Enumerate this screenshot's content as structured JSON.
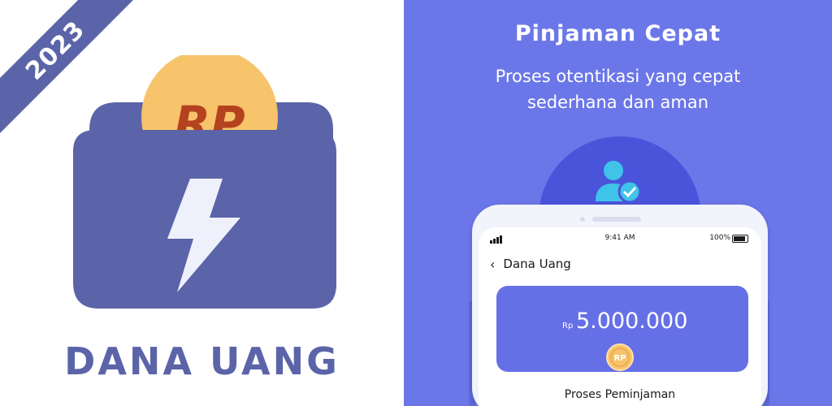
{
  "left": {
    "ribbon_text": "2023",
    "coin_text": "RP",
    "brand_name": "DANA UANG"
  },
  "right": {
    "headline": "Pinjaman Cepat",
    "subtext_line1": "Proses otentikasi yang cepat",
    "subtext_line2": "sederhana dan aman",
    "phone": {
      "time": "9:41 AM",
      "battery": "100%",
      "nav_title": "Dana Uang",
      "currency": "Rp",
      "amount": "5.000.000",
      "coin_text": "RP",
      "process_label": "Proses Peminjaman"
    }
  },
  "colors": {
    "brand": "#5b64a8",
    "coin": "#f7c36b",
    "coin_text": "#b5421e",
    "right_bg": "#6b77e8",
    "card": "#6670e6"
  }
}
